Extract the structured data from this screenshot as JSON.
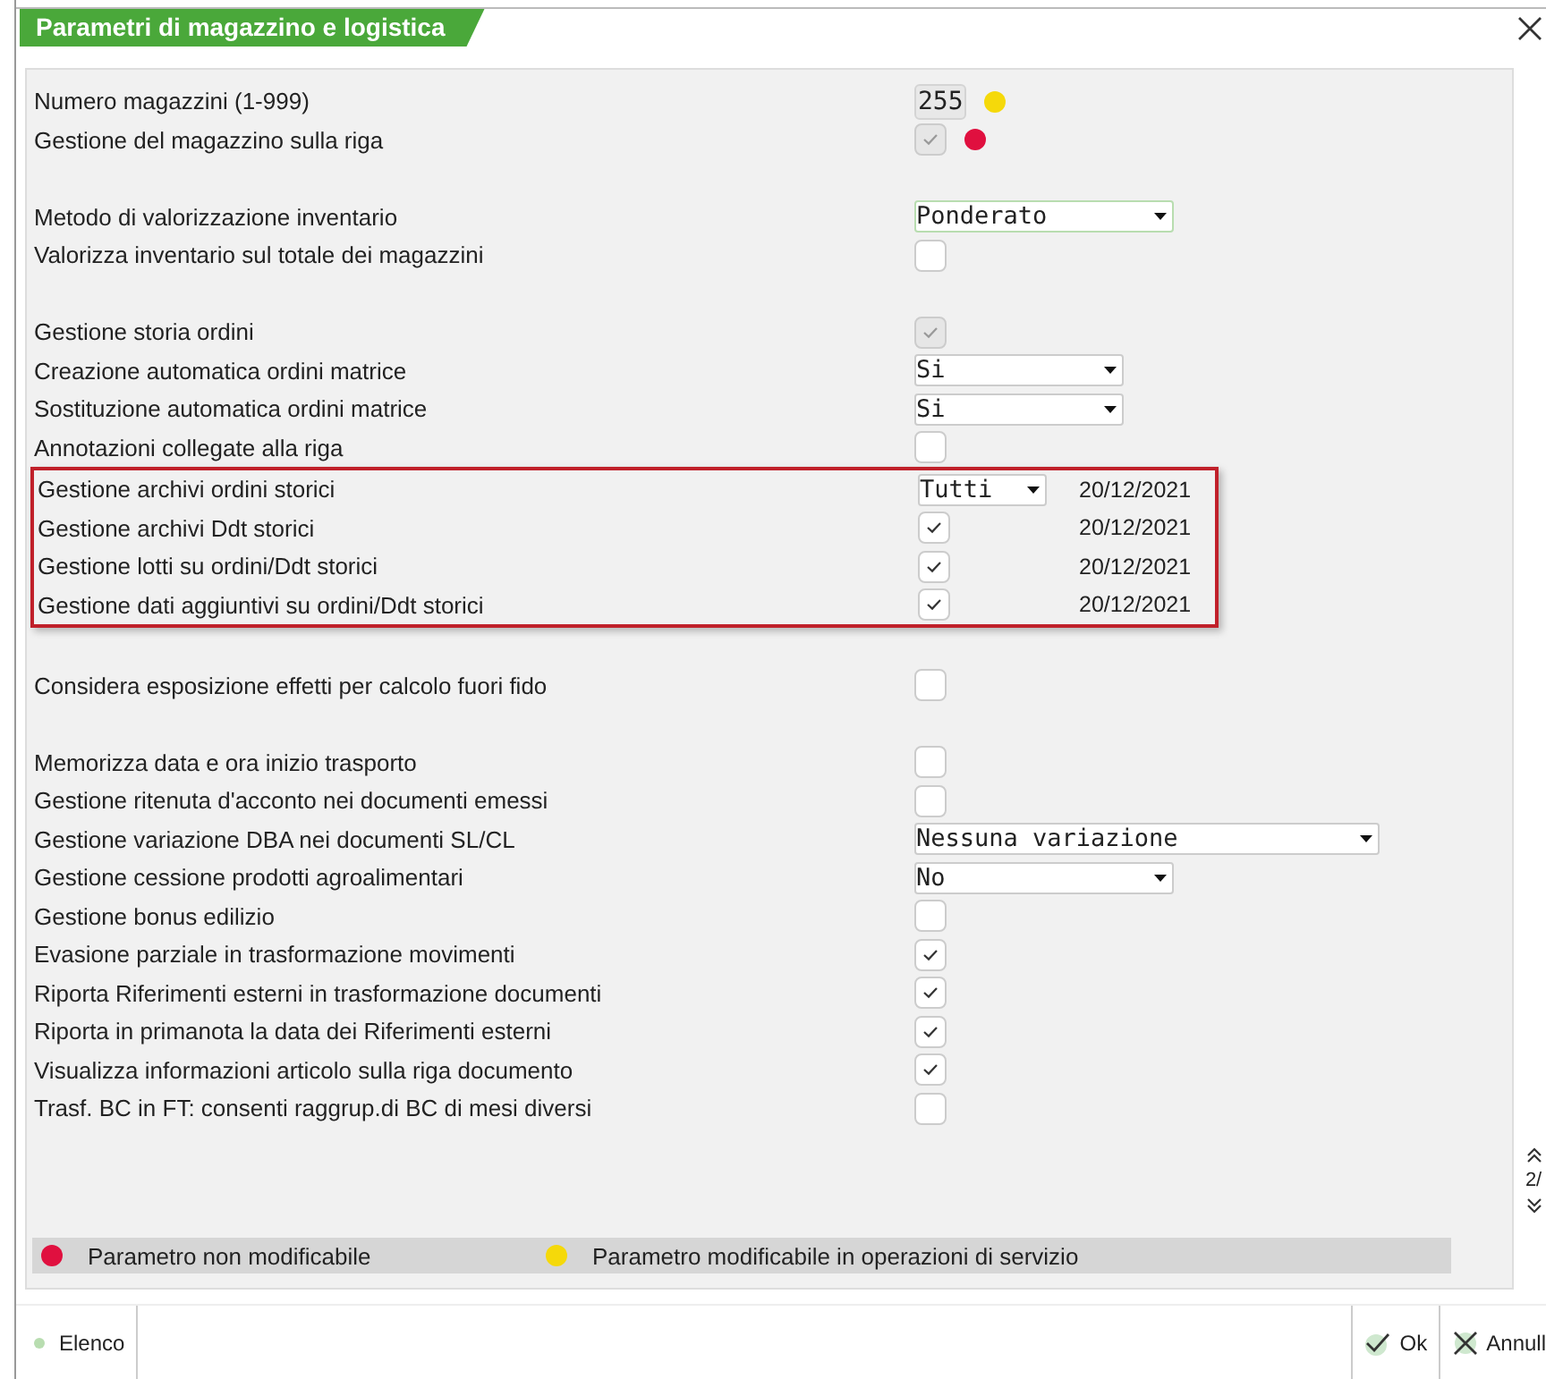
{
  "window": {
    "title": "Parametri di magazzino e logistica"
  },
  "blocks": [
    {
      "groups": [
        {
          "boxed": false,
          "rows": [
            {
              "label": "Numero magazzini (1-999)",
              "kind": "number",
              "value": "255",
              "color": "#f5d90a"
            },
            {
              "label": "Gestione del magazzino sulla riga",
              "kind": "checkbox",
              "checked": true,
              "disabled": true,
              "color": "#e0103f"
            }
          ]
        }
      ]
    },
    {
      "groups": [
        {
          "boxed": false,
          "rows": [
            {
              "label": "Metodo di valorizzazione inventario",
              "kind": "select",
              "value": "Ponderato",
              "focused": true
            },
            {
              "label": "Valorizza inventario sul totale dei magazzini",
              "kind": "checkbox",
              "checked": false,
              "disabled": false
            }
          ]
        }
      ]
    },
    {
      "groups": [
        {
          "boxed": false,
          "rows": [
            {
              "label": "Gestione storia ordini",
              "kind": "checkbox",
              "checked": true,
              "disabled": true
            },
            {
              "label": "Creazione automatica ordini matrice",
              "kind": "select",
              "value": "Si",
              "focused": false
            },
            {
              "label": "Sostituzione automatica ordini matrice",
              "kind": "select",
              "value": "Si",
              "focused": false
            },
            {
              "label": "Annotazioni collegate alla riga",
              "kind": "checkbox",
              "checked": false,
              "disabled": false
            }
          ]
        },
        {
          "boxed": true,
          "rows": [
            {
              "label": "Gestione archivi ordini storici",
              "kind": "select",
              "value": "Tutti",
              "focused": false,
              "date": "20/12/2021"
            },
            {
              "label": "Gestione archivi Ddt storici",
              "kind": "checkbox",
              "checked": true,
              "disabled": false,
              "date": "20/12/2021"
            },
            {
              "label": "Gestione lotti su ordini/Ddt storici",
              "kind": "checkbox",
              "checked": true,
              "disabled": false,
              "date": "20/12/2021"
            },
            {
              "label": "Gestione dati aggiuntivi su ordini/Ddt storici",
              "kind": "checkbox",
              "checked": true,
              "disabled": false,
              "date": "20/12/2021"
            }
          ]
        }
      ]
    },
    {
      "groups": [
        {
          "boxed": false,
          "rows": [
            {
              "label": "Considera esposizione effetti per calcolo fuori fido",
              "kind": "checkbox",
              "checked": false,
              "disabled": false
            }
          ]
        }
      ]
    },
    {
      "groups": [
        {
          "boxed": false,
          "rows": [
            {
              "label": "Memorizza data e ora inizio trasporto",
              "kind": "checkbox",
              "checked": false,
              "disabled": false
            },
            {
              "label": "Gestione ritenuta d'acconto nei documenti emessi",
              "kind": "checkbox",
              "checked": false,
              "disabled": false
            },
            {
              "label": "Gestione variazione DBA nei documenti SL/CL",
              "kind": "select",
              "value": "Nessuna variazione",
              "focused": false
            },
            {
              "label": "Gestione cessione prodotti agroalimentari",
              "kind": "select",
              "value": "No",
              "focused": false
            },
            {
              "label": "Gestione bonus edilizio",
              "kind": "checkbox",
              "checked": false,
              "disabled": false
            },
            {
              "label": "Evasione parziale in trasformazione movimenti",
              "kind": "checkbox",
              "checked": true,
              "disabled": false
            },
            {
              "label": "Riporta Riferimenti esterni in trasformazione documenti",
              "kind": "checkbox",
              "checked": true,
              "disabled": false
            },
            {
              "label": "Riporta in primanota la data dei Riferimenti esterni",
              "kind": "checkbox",
              "checked": true,
              "disabled": false
            },
            {
              "label": "Visualizza informazioni articolo sulla riga documento",
              "kind": "checkbox",
              "checked": true,
              "disabled": false
            },
            {
              "label": "Trasf. BC in FT: consenti raggrup.di BC di mesi diversi",
              "kind": "checkbox",
              "checked": false,
              "disabled": false
            }
          ]
        }
      ]
    }
  ],
  "legend": [
    {
      "label": "Parametro non modificabile",
      "color": "#e0103f"
    },
    {
      "label": "Parametro modificabile in operazioni di servizio",
      "color": "#f5d90a"
    }
  ],
  "pager": "2/",
  "footer": {
    "left": "Elenco",
    "ok": "Ok",
    "cancel": "Annull"
  }
}
